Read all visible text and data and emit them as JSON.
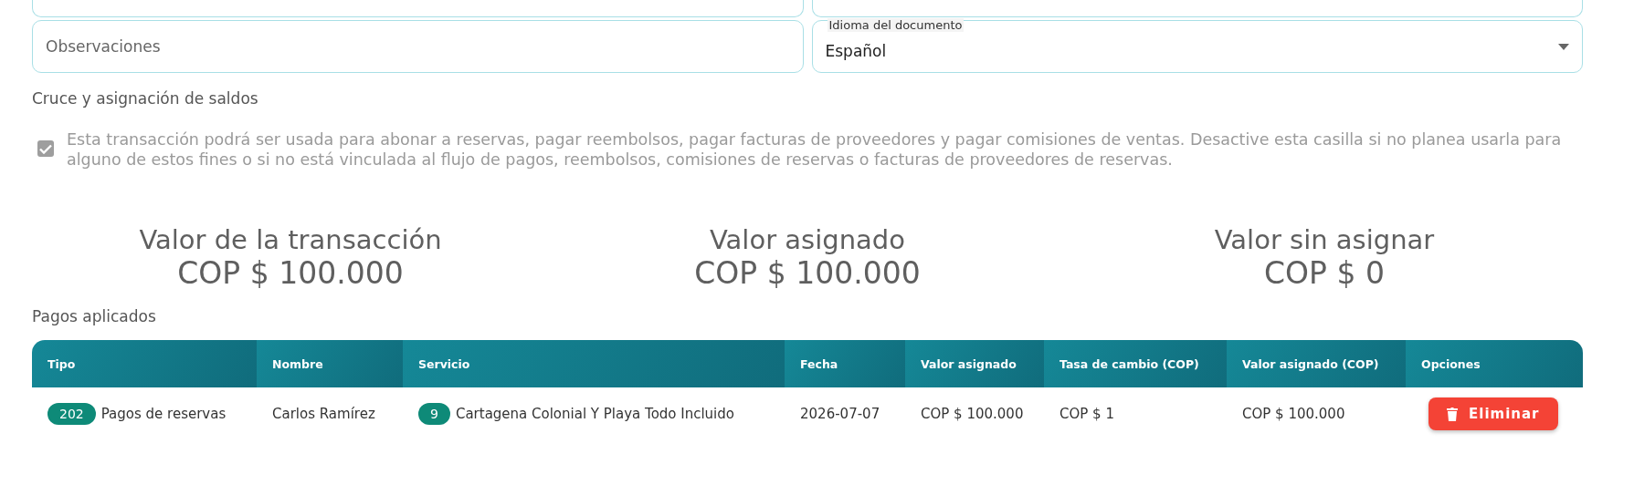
{
  "fields_row_1": [
    {
      "kind": "text"
    },
    {
      "kind": "text"
    }
  ],
  "observaciones": {
    "placeholder": "Observaciones"
  },
  "idioma": {
    "label": "Idioma del documento",
    "value": "Español"
  },
  "cruce": {
    "title": "Cruce y asignación de saldos",
    "checked": true,
    "disabled": true,
    "text": "Esta transacción podrá ser usada para abonar a reservas, pagar reembolsos, pagar facturas de proveedores y pagar comisiones de ventas. Desactive esta casilla si no planea usarla para alguno de estos fines o si no está vinculada al flujo de pagos, reembolsos, comisiones de reservas o facturas de proveedores de reservas."
  },
  "summary": [
    {
      "label": "Valor de la transacción",
      "value": "COP $ 100.000"
    },
    {
      "label": "Valor asignado",
      "value": "COP $ 100.000"
    },
    {
      "label": "Valor sin asignar",
      "value": "COP $ 0"
    }
  ],
  "pagos": {
    "title": "Pagos aplicados",
    "columns": [
      "Tipo",
      "Nombre",
      "Servicio",
      "Fecha",
      "Valor asignado",
      "Tasa de cambio (COP)",
      "Valor asignado (COP)",
      "Opciones"
    ],
    "rows": [
      {
        "tipo_badge": "202",
        "tipo": "Pagos de reservas",
        "nombre": "Carlos Ramírez",
        "servicio_badge": "9",
        "servicio": "Cartagena Colonial Y Playa Todo Incluido",
        "fecha": "2026-07-07",
        "valor": "COP $ 100.000",
        "tasa": "COP $ 1",
        "valor_cop": "COP $ 100.000",
        "action": "Eliminar"
      }
    ]
  }
}
